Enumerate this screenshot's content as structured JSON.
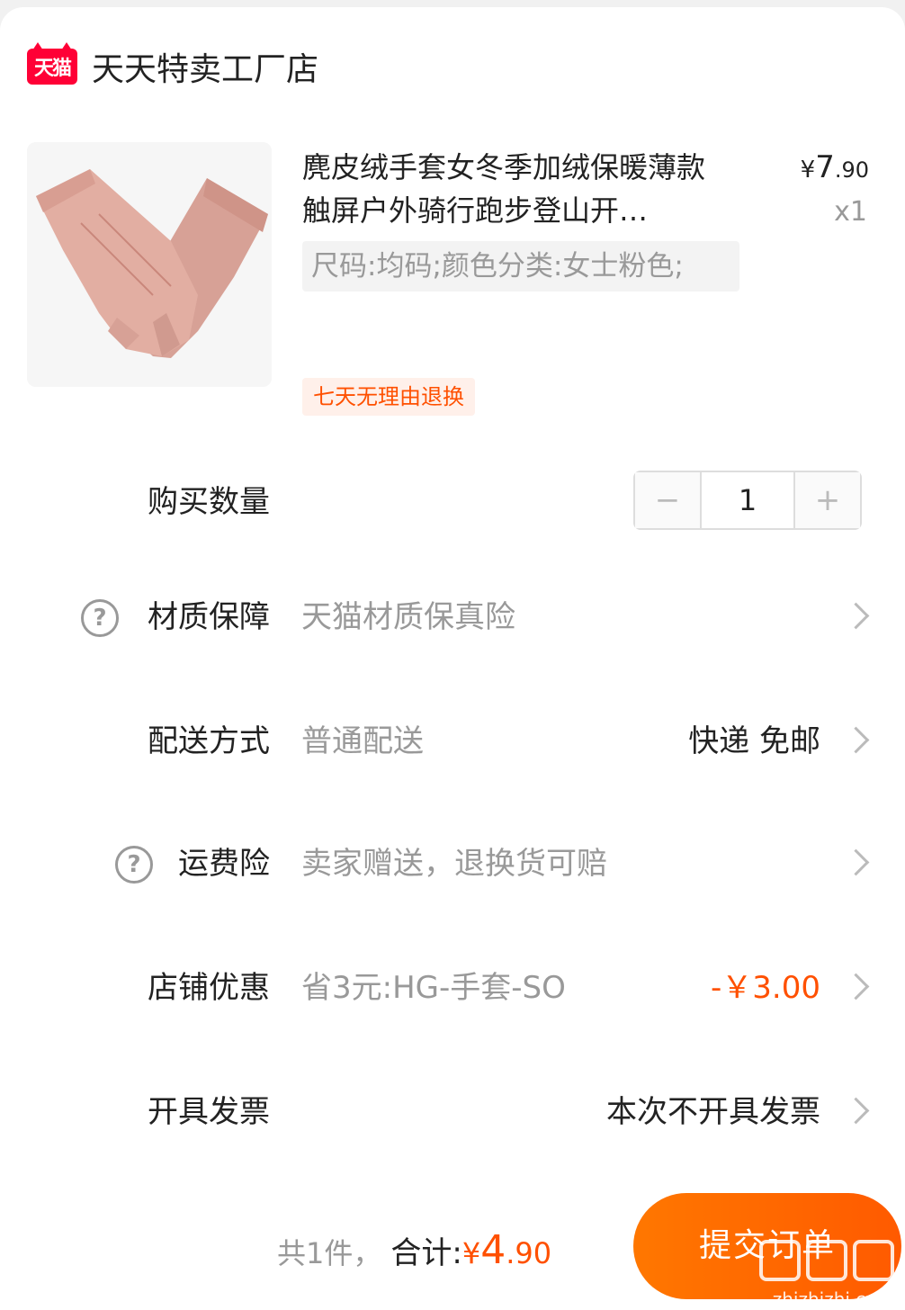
{
  "shop": {
    "logo_text": "天猫",
    "name": "天天特卖工厂店"
  },
  "product": {
    "title": "麂皮绒手套女冬季加绒保暖薄款触屏户外骑行跑步登山开…",
    "price_symbol": "¥",
    "price_int": "7",
    "price_dec": ".90",
    "quantity": "x1",
    "sku": "尺码:均码;颜色分类:女士粉色;",
    "tag": "七天无理由退换",
    "image_icon": "pink-gloves-image"
  },
  "rows": {
    "buy_qty": {
      "label": "购买数量",
      "value": "1",
      "minus": "−",
      "plus": "+"
    },
    "material": {
      "label": "材质保障",
      "value": "天猫材质保真险",
      "help_icon": "?"
    },
    "delivery": {
      "label": "配送方式",
      "value": "普通配送",
      "right": "快递 免邮"
    },
    "shipping_insurance": {
      "label": "运费险",
      "value": "卖家赠送，退换货可赔",
      "help_icon": "?"
    },
    "store_discount": {
      "label": "店铺优惠",
      "value": "省3元:HG-手套-SO",
      "right": "-￥3.00"
    },
    "invoice": {
      "label": "开具发票",
      "right": "本次不开具发票"
    }
  },
  "footer": {
    "count": "共1件，",
    "total_label": "合计:",
    "total_symbol": "¥",
    "total_int": "4",
    "total_dec": ".90",
    "submit_label": "提交订单",
    "watermark_url": "zhizhizhi.com"
  },
  "colors": {
    "accent": "#ff5000",
    "tmall_red": "#ff0036",
    "muted": "#999999"
  }
}
